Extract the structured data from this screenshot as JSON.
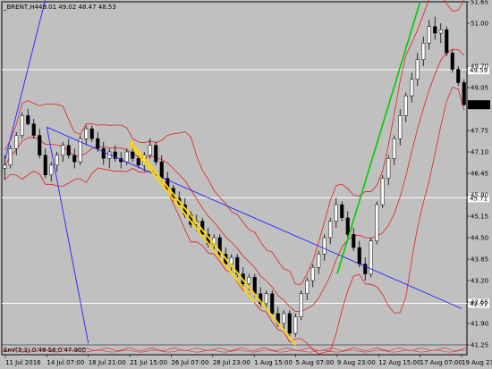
{
  "window": {
    "title": "_BRENT,H4",
    "ohlc": "49.01 49.02 48.47 48.53",
    "indicator_label": "Env(3,3) 0.48 56.0 47.900"
  },
  "chart_data": {
    "type": "candlestick",
    "symbol": "_BRENT",
    "timeframe": "H4",
    "ylim": [
      41.25,
      51.65
    ],
    "y_ticks": [
      51.65,
      51.0,
      49.7,
      49.05,
      47.75,
      47.1,
      46.45,
      45.8,
      45.15,
      44.5,
      43.85,
      43.2,
      42.55,
      41.9,
      41.25
    ],
    "x_ticks": [
      "11 Jul 2016",
      "14 Jul 07:00",
      "18 Jul 21:00",
      "21 Jul 15:00",
      "26 Jul 07:00",
      "28 Jul 23:00",
      "1 Aug 15:00",
      "5 Aug 07:00",
      "9 Aug 23:00",
      "12 Aug 15:00",
      "17 Aug 07:00",
      "19 Aug 23:00"
    ],
    "last_price": "48.53",
    "horizontal_levels": [
      {
        "label": "49.59",
        "value": 49.59
      },
      {
        "label": "45.71",
        "value": 45.71
      },
      {
        "label": "42.51",
        "value": 42.51
      }
    ],
    "trendlines": [
      {
        "color": "#2020ff",
        "from": [
          "11 Jul 2016",
          46.9
        ],
        "to": [
          "14 Jul 07:00",
          51.9
        ]
      },
      {
        "color": "#2020ff",
        "from": [
          "14 Jul 07:00",
          47.85
        ],
        "to": [
          "18 Jul 21:00",
          41.3
        ]
      },
      {
        "color": "#2020ff",
        "from": [
          "14 Jul 07:00",
          47.85
        ],
        "to": [
          "19 Aug 23:00",
          42.35
        ]
      },
      {
        "color": "#ffd700",
        "from": [
          "21 Jul 15:00",
          47.45
        ],
        "to": [
          "5 Aug 07:00",
          41.25
        ]
      },
      {
        "color": "#ffd700",
        "from": [
          "21 Jul 15:00",
          47.35
        ],
        "to": [
          "1 Aug 15:00",
          42.55
        ]
      },
      {
        "color": "#00cc00",
        "from": [
          "9 Aug 23:00",
          43.4
        ],
        "to": [
          "17 Aug 07:00",
          51.65
        ]
      }
    ],
    "colors": {
      "background": "#c0c0c0",
      "candle_up": "#ffffff",
      "candle_down": "#000000",
      "bands": "#dd2222",
      "grid_level": "#ffffff"
    },
    "candles": [
      [
        46.6,
        47.0,
        46.25,
        46.7
      ],
      [
        46.7,
        47.3,
        46.6,
        47.2
      ],
      [
        47.2,
        47.7,
        47.0,
        47.6
      ],
      [
        47.6,
        48.3,
        47.5,
        48.2
      ],
      [
        48.2,
        48.4,
        47.9,
        47.95
      ],
      [
        47.95,
        48.1,
        47.5,
        47.6
      ],
      [
        47.6,
        47.8,
        46.9,
        47.0
      ],
      [
        47.0,
        47.2,
        46.3,
        46.4
      ],
      [
        46.4,
        46.8,
        46.2,
        46.7
      ],
      [
        46.7,
        47.1,
        46.5,
        47.0
      ],
      [
        47.0,
        47.4,
        46.8,
        47.3
      ],
      [
        47.3,
        47.5,
        46.9,
        47.0
      ],
      [
        47.0,
        47.2,
        46.6,
        46.8
      ],
      [
        46.8,
        47.6,
        46.7,
        47.5
      ],
      [
        47.5,
        47.9,
        47.3,
        47.8
      ],
      [
        47.8,
        47.9,
        47.4,
        47.5
      ],
      [
        47.5,
        47.7,
        47.1,
        47.2
      ],
      [
        47.2,
        47.4,
        46.7,
        46.9
      ],
      [
        46.9,
        47.2,
        46.6,
        47.1
      ],
      [
        47.1,
        47.3,
        46.8,
        46.9
      ],
      [
        46.9,
        47.1,
        46.6,
        46.8
      ],
      [
        46.8,
        47.2,
        46.7,
        47.1
      ],
      [
        47.1,
        47.3,
        46.8,
        46.9
      ],
      [
        46.9,
        47.0,
        46.6,
        46.7
      ],
      [
        46.7,
        47.1,
        46.5,
        47.0
      ],
      [
        47.0,
        47.5,
        46.9,
        47.3
      ],
      [
        47.3,
        47.4,
        46.7,
        46.8
      ],
      [
        46.8,
        47.0,
        46.2,
        46.3
      ],
      [
        46.3,
        46.5,
        45.9,
        46.0
      ],
      [
        46.0,
        46.1,
        45.6,
        45.7
      ],
      [
        45.7,
        45.9,
        45.4,
        45.5
      ],
      [
        45.5,
        45.7,
        45.1,
        45.2
      ],
      [
        45.2,
        45.3,
        44.8,
        44.9
      ],
      [
        44.9,
        45.2,
        44.7,
        45.0
      ],
      [
        45.0,
        45.1,
        44.5,
        44.6
      ],
      [
        44.6,
        44.8,
        44.2,
        44.3
      ],
      [
        44.3,
        44.6,
        44.1,
        44.5
      ],
      [
        44.5,
        44.6,
        43.9,
        44.0
      ],
      [
        44.0,
        44.2,
        43.6,
        43.7
      ],
      [
        43.7,
        44.0,
        43.5,
        43.9
      ],
      [
        43.9,
        44.0,
        43.3,
        43.4
      ],
      [
        43.4,
        43.6,
        43.0,
        43.1
      ],
      [
        43.1,
        43.4,
        42.9,
        43.3
      ],
      [
        43.3,
        43.4,
        42.7,
        42.8
      ],
      [
        42.8,
        43.0,
        42.4,
        42.5
      ],
      [
        42.5,
        42.9,
        42.3,
        42.8
      ],
      [
        42.8,
        42.9,
        42.1,
        42.2
      ],
      [
        42.2,
        42.4,
        41.8,
        41.9
      ],
      [
        41.9,
        42.3,
        41.7,
        42.2
      ],
      [
        42.2,
        42.3,
        41.5,
        41.6
      ],
      [
        41.6,
        42.2,
        41.5,
        42.1
      ],
      [
        42.1,
        42.9,
        42.0,
        42.8
      ],
      [
        42.8,
        43.3,
        42.6,
        43.2
      ],
      [
        43.2,
        43.7,
        43.0,
        43.6
      ],
      [
        43.6,
        44.1,
        43.4,
        44.0
      ],
      [
        44.0,
        44.6,
        43.8,
        44.5
      ],
      [
        44.5,
        45.1,
        44.3,
        45.0
      ],
      [
        45.0,
        45.7,
        44.8,
        45.5
      ],
      [
        45.5,
        45.6,
        45.0,
        45.1
      ],
      [
        45.1,
        45.3,
        44.5,
        44.6
      ],
      [
        44.6,
        44.8,
        44.1,
        44.2
      ],
      [
        44.2,
        44.4,
        43.6,
        43.7
      ],
      [
        43.7,
        43.9,
        43.2,
        43.4
      ],
      [
        43.4,
        44.5,
        43.3,
        44.4
      ],
      [
        44.4,
        45.6,
        44.3,
        45.5
      ],
      [
        45.5,
        46.4,
        45.4,
        46.3
      ],
      [
        46.3,
        47.0,
        46.1,
        46.9
      ],
      [
        46.9,
        47.6,
        46.7,
        47.5
      ],
      [
        47.5,
        48.4,
        47.3,
        48.2
      ],
      [
        48.2,
        48.9,
        48.0,
        48.8
      ],
      [
        48.8,
        49.5,
        48.6,
        49.3
      ],
      [
        49.3,
        50.1,
        49.1,
        49.9
      ],
      [
        49.9,
        50.6,
        49.7,
        50.4
      ],
      [
        50.4,
        51.1,
        50.2,
        50.9
      ],
      [
        50.9,
        51.2,
        50.5,
        50.7
      ],
      [
        50.7,
        51.0,
        50.4,
        50.8
      ],
      [
        50.8,
        50.9,
        50.0,
        50.1
      ],
      [
        50.1,
        50.2,
        49.5,
        49.6
      ],
      [
        49.6,
        49.7,
        49.1,
        49.2
      ],
      [
        49.2,
        49.3,
        48.5,
        48.53
      ]
    ]
  }
}
